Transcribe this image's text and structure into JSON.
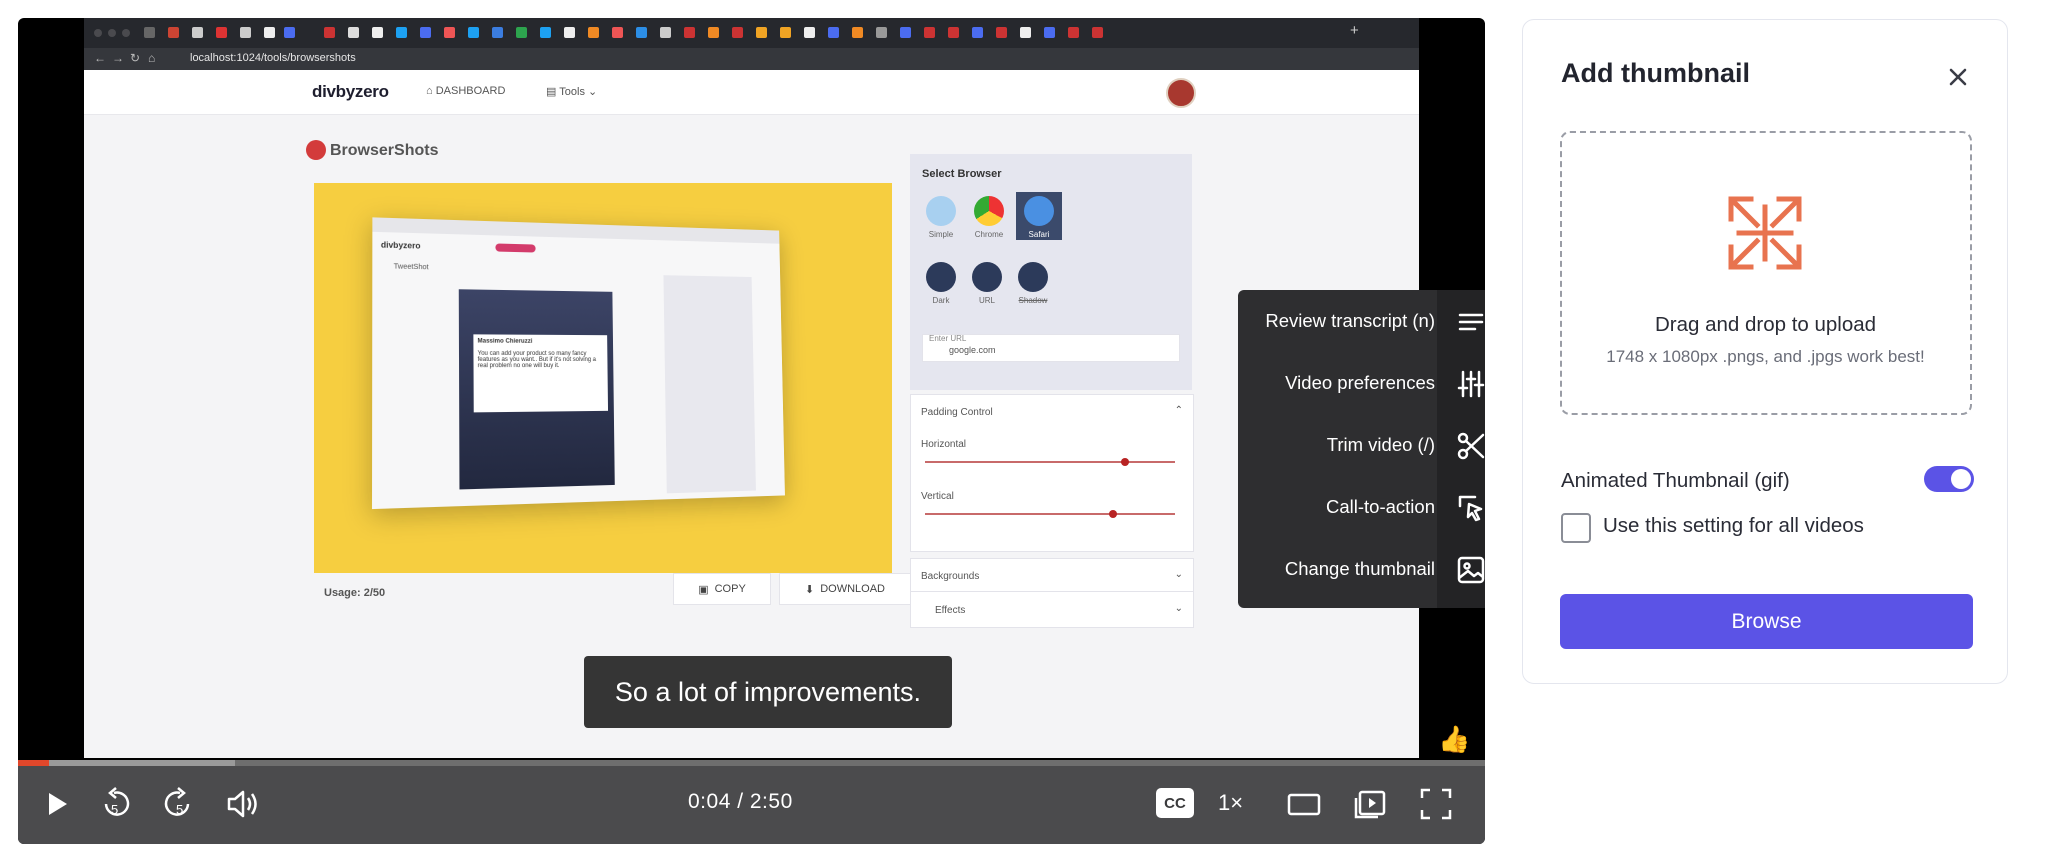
{
  "browser": {
    "url": "localhost:1024/tools/browsershots"
  },
  "app": {
    "logo": "divbyzero",
    "nav": {
      "dashboard": "DASHBOARD",
      "tools": "Tools"
    },
    "title": "BrowserShots",
    "usage": "Usage: 2/50",
    "copy_label": "COPY",
    "download_label": "DOWNLOAD",
    "select_browser": "Select Browser",
    "browsers": [
      "Simple",
      "Chrome",
      "Safari"
    ],
    "modes": [
      "Dark",
      "URL",
      "Shadow"
    ],
    "enter_url_label": "Enter URL",
    "enter_url_value": "google.com",
    "padding_control": "Padding Control",
    "horizontal": "Horizontal",
    "vertical": "Vertical",
    "horizontal_value": 0.8,
    "vertical_value": 0.75,
    "backgrounds": "Backgrounds",
    "effects": "Effects"
  },
  "caption": "So a lot of improvements.",
  "menu": {
    "items": [
      {
        "label": "Review transcript (n)",
        "icon": "transcript-icon"
      },
      {
        "label": "Video preferences",
        "icon": "sliders-icon"
      },
      {
        "label": "Trim video (/)",
        "icon": "scissors-icon"
      },
      {
        "label": "Call-to-action",
        "icon": "pointer-icon"
      },
      {
        "label": "Change thumbnail",
        "icon": "image-icon"
      }
    ]
  },
  "player": {
    "time": "0:04 / 2:50",
    "progress": 0.021,
    "buffered": 0.148,
    "cc": "CC",
    "speed": "1×",
    "skip_back": "5",
    "skip_forward": "5"
  },
  "thumbnail": {
    "title": "Add thumbnail",
    "drop_title": "Drag and drop to upload",
    "drop_sub": "1748 x 1080px .pngs, and .jpgs work best!",
    "animated_label": "Animated Thumbnail (gif)",
    "animated_on": true,
    "all_videos_label": "Use this setting for all videos",
    "browse_label": "Browse"
  },
  "colors": {
    "accent": "#5b53e6",
    "progress": "#e0472b",
    "upload_icon": "#e8734f",
    "stage": "#f6ce40"
  }
}
